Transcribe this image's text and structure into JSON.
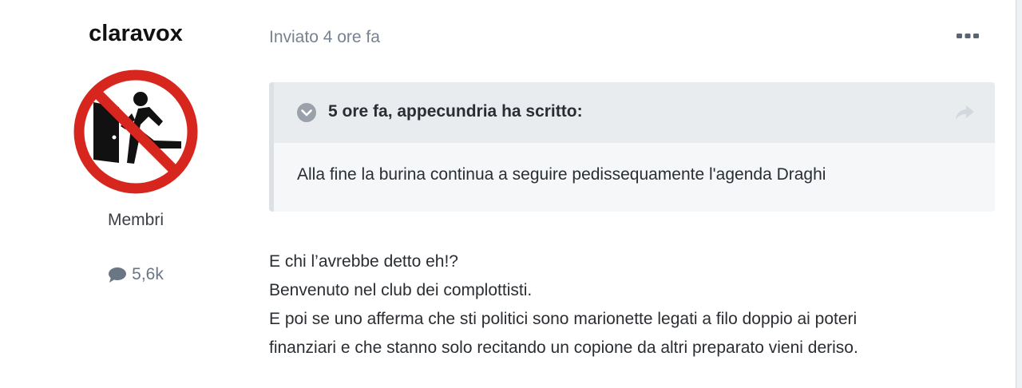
{
  "author": {
    "username": "claravox",
    "role": "Membri",
    "post_count": "5,6k"
  },
  "post": {
    "posted_time": "Inviato 4 ore fa",
    "quote": {
      "citation": "5 ore fa, appecundria ha scritto:",
      "text": "Alla fine la burina continua a seguire pedissequamente l'agenda Draghi"
    },
    "body": [
      "E chi l’avrebbe detto eh!?",
      "Benvenuto nel club dei complottisti.",
      "E poi se uno afferma che sti politici sono marionette legati a filo doppio ai poteri",
      "finanziari e che stanno solo recitando un copione da altri preparato vieni deriso."
    ]
  },
  "icons": {
    "avatar": "no-exit-sign",
    "posts": "speech-bubble-icon",
    "more": "ellipsis-icon",
    "quote_toggle": "chevron-down-circle-icon",
    "share": "share-arrow-icon"
  },
  "colors": {
    "quote_background": "#f5f7f9",
    "quote_header": "#e9ecef",
    "muted_text": "#78828f",
    "avatar_red": "#d7261e"
  }
}
